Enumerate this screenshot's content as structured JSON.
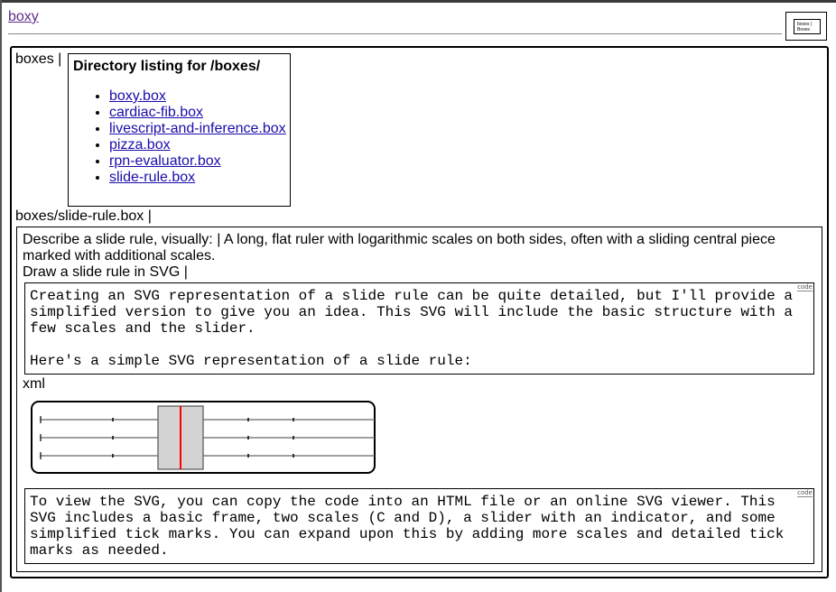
{
  "header": {
    "site_link": "boxy",
    "thumbnail": {
      "line1": "boxes |",
      "line2": "Boxes"
    }
  },
  "boxes_label": "boxes |",
  "directory": {
    "title": "Directory listing for /boxes/",
    "items": [
      "boxy.box",
      "cardiac-fib.box",
      "livescript-and-inference.box",
      "pizza.box",
      "rpn-evaluator.box",
      "slide-rule.box"
    ]
  },
  "box_path": "boxes/slide-rule.box |",
  "content": {
    "describe": "Describe a slide rule, visually: | A long, flat ruler with logarithmic scales on both sides, often with a sliding central piece marked with additional scales.",
    "draw": "Draw a slide rule in SVG |",
    "code_block_1": "Creating an SVG representation of a slide rule can be quite detailed, but I'll provide a simplified version to give you an idea. This SVG will include the basic structure with a few scales and the slider.\n\nHere's a simple SVG representation of a slide rule:",
    "code_tag": "code",
    "xml_label": "xml",
    "code_block_2": "To view the SVG, you can copy the code into an HTML file or an online SVG viewer. This SVG includes a basic frame, two scales (C and D), a slider with an indicator, and some simplified tick marks. You can expand upon this by adding more scales and detailed tick marks as needed."
  },
  "colors": {
    "link": "#1a0dab",
    "visited_link": "#5b2d8e",
    "slider_fill": "#d3d3d3",
    "indicator": "#ff0000"
  }
}
